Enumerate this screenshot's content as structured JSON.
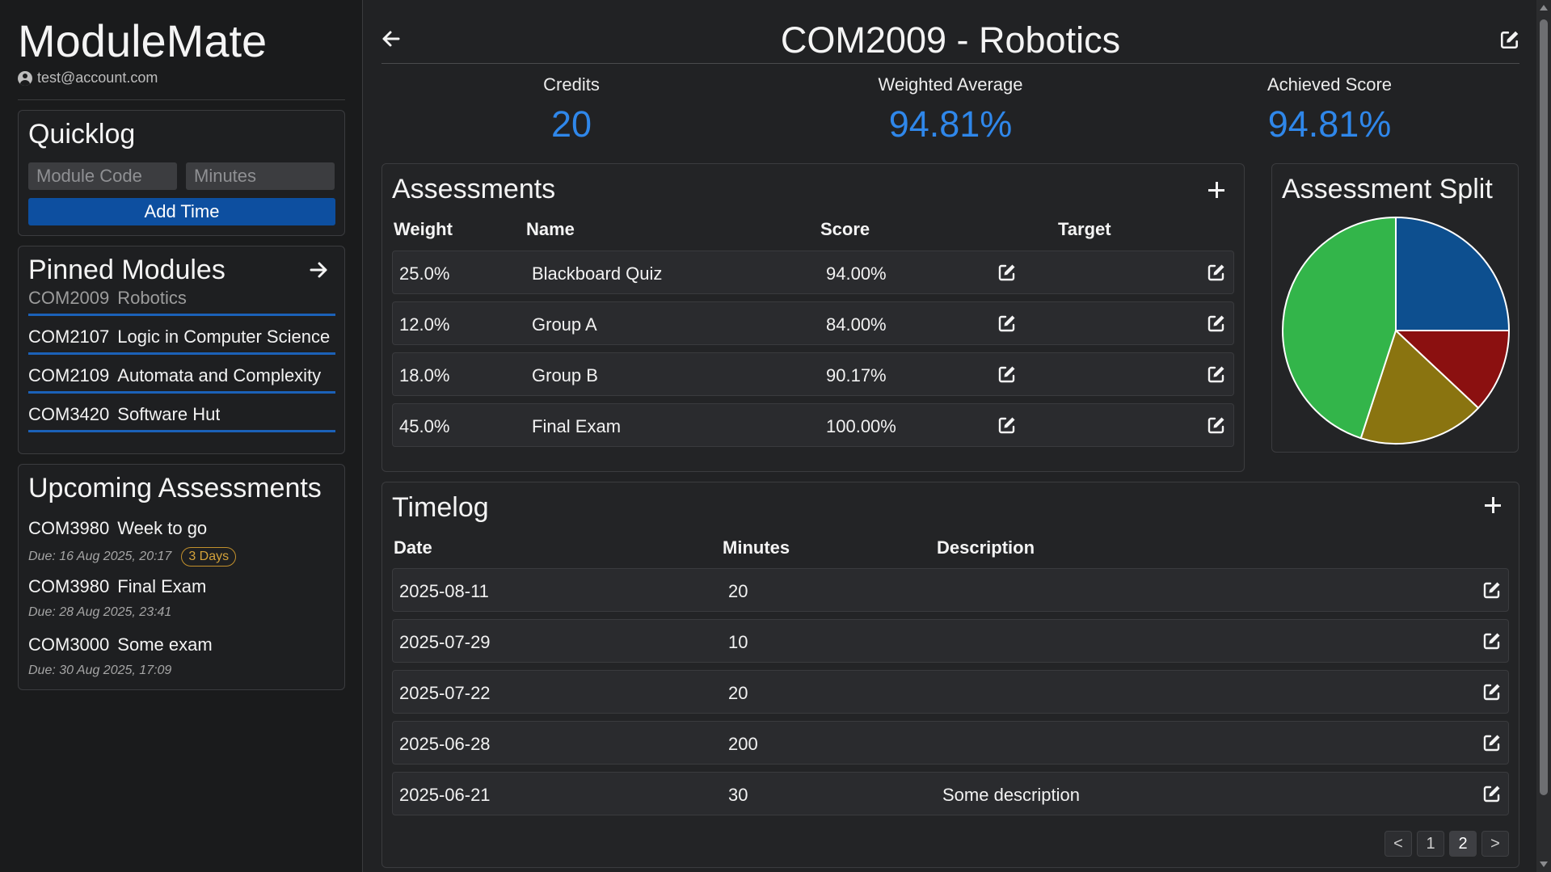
{
  "app": {
    "title": "ModuleMate",
    "account": "test@account.com"
  },
  "quicklog": {
    "title": "Quicklog",
    "module_placeholder": "Module Code",
    "minutes_placeholder": "Minutes",
    "add_label": "Add Time"
  },
  "pinned": {
    "title": "Pinned Modules",
    "items": [
      {
        "code": "COM2009",
        "name": "Robotics",
        "active": true
      },
      {
        "code": "COM2107",
        "name": "Logic in Computer Science",
        "active": false
      },
      {
        "code": "COM2109",
        "name": "Automata and Complexity",
        "active": false
      },
      {
        "code": "COM3420",
        "name": "Software Hut",
        "active": false
      }
    ]
  },
  "upcoming": {
    "title": "Upcoming Assessments",
    "items": [
      {
        "code": "COM3980",
        "name": "Week to go",
        "due": "Due: 16 Aug 2025, 20:17",
        "badge": "3 Days"
      },
      {
        "code": "COM3980",
        "name": "Final Exam",
        "due": "Due: 28 Aug 2025, 23:41"
      },
      {
        "code": "COM3000",
        "name": "Some exam",
        "due": "Due: 30 Aug 2025, 17:09"
      }
    ]
  },
  "module": {
    "title": "COM2009 - Robotics",
    "stats": [
      {
        "label": "Credits",
        "value": "20"
      },
      {
        "label": "Weighted Average",
        "value": "94.81%"
      },
      {
        "label": "Achieved Score",
        "value": "94.81%"
      }
    ]
  },
  "assessments": {
    "title": "Assessments",
    "headers": {
      "weight": "Weight",
      "name": "Name",
      "score": "Score",
      "target": "Target"
    },
    "rows": [
      {
        "weight": "25.0%",
        "name": "Blackboard Quiz",
        "score": "94.00%"
      },
      {
        "weight": "12.0%",
        "name": "Group A",
        "score": "84.00%"
      },
      {
        "weight": "18.0%",
        "name": "Group B",
        "score": "90.17%"
      },
      {
        "weight": "45.0%",
        "name": "Final Exam",
        "score": "100.00%"
      }
    ]
  },
  "split": {
    "title": "Assessment Split",
    "slices": [
      {
        "value": 25,
        "color": "#0d4f8f"
      },
      {
        "value": 12,
        "color": "#8b1010"
      },
      {
        "value": 18,
        "color": "#8a7410"
      },
      {
        "value": 45,
        "color": "#33b54a"
      }
    ]
  },
  "timelog": {
    "title": "Timelog",
    "headers": {
      "date": "Date",
      "minutes": "Minutes",
      "description": "Description"
    },
    "rows": [
      {
        "date": "2025-08-11",
        "minutes": "20",
        "description": ""
      },
      {
        "date": "2025-07-29",
        "minutes": "10",
        "description": ""
      },
      {
        "date": "2025-07-22",
        "minutes": "20",
        "description": ""
      },
      {
        "date": "2025-06-28",
        "minutes": "200",
        "description": ""
      },
      {
        "date": "2025-06-21",
        "minutes": "30",
        "description": "Some description"
      }
    ]
  },
  "pagination": {
    "prev": "<",
    "pages": [
      "1",
      "2"
    ],
    "current": "2",
    "next": ">"
  }
}
